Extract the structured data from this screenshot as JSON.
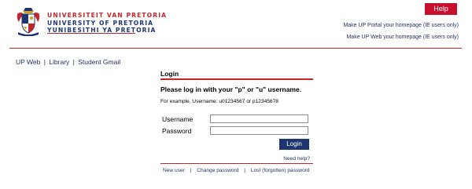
{
  "header": {
    "university_names": [
      "UNIVERSITEIT VAN PRETORIA",
      "UNIVERSITY OF PRETORIA",
      "YUNIBESITHI YA PRETORIA"
    ],
    "help_label": "Help",
    "homepage_portal": "Make UP Portal your homepage (IE users only)",
    "homepage_web": "Make UP Web your homepage (IE users only)"
  },
  "nav": {
    "links": [
      "UP Web",
      "Library",
      "Student Gmail"
    ],
    "separator": "|"
  },
  "login": {
    "title": "Login",
    "prompt": "Please log in with your \"p\" or \"u\" username.",
    "example": "For example, Username: u01234567 or p12345678",
    "username_label": "Username",
    "password_label": "Password",
    "username_value": "",
    "password_value": "",
    "button_label": "Login",
    "need_help": "Need help?"
  },
  "footer": {
    "links": [
      "New user",
      "Change password",
      "Lost (forgotten) password"
    ],
    "separator": "|"
  },
  "colors": {
    "brand_red": "#c0272d",
    "brand_navy": "#1f3570",
    "help_red": "#c8102e"
  },
  "icons": {
    "logo": "university-crest-icon"
  }
}
